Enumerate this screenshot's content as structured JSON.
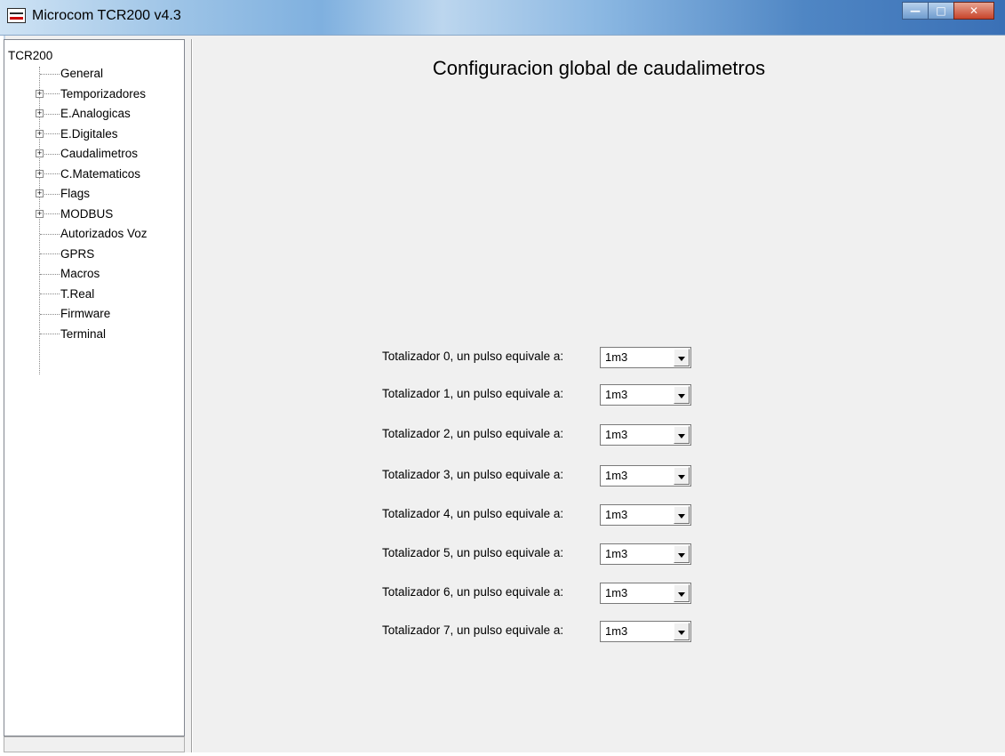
{
  "window": {
    "title": "Microcom TCR200 v4.3",
    "controls": [
      "minimize-icon",
      "maximize-icon",
      "close-icon"
    ]
  },
  "tree": {
    "root": "TCR200",
    "items": [
      {
        "label": "General",
        "expandable": false
      },
      {
        "label": "Temporizadores",
        "expandable": true
      },
      {
        "label": "E.Analogicas",
        "expandable": true
      },
      {
        "label": "E.Digitales",
        "expandable": true
      },
      {
        "label": "Caudalimetros",
        "expandable": true
      },
      {
        "label": "C.Matematicos",
        "expandable": true
      },
      {
        "label": "Flags",
        "expandable": true
      },
      {
        "label": "MODBUS",
        "expandable": true
      },
      {
        "label": "Autorizados Voz",
        "expandable": false
      },
      {
        "label": "GPRS",
        "expandable": false
      },
      {
        "label": "Macros",
        "expandable": false
      },
      {
        "label": "T.Real",
        "expandable": false
      },
      {
        "label": "Firmware",
        "expandable": false
      },
      {
        "label": "Terminal",
        "expandable": false
      }
    ]
  },
  "main": {
    "title": "Configuracion global de caudalimetros",
    "totalizers": [
      {
        "label": "Totalizador 0, un pulso equivale a:",
        "value": "1m3"
      },
      {
        "label": "Totalizador 1, un pulso equivale a:",
        "value": "1m3"
      },
      {
        "label": "Totalizador 2, un pulso equivale a:",
        "value": "1m3"
      },
      {
        "label": "Totalizador 3, un pulso equivale a:",
        "value": "1m3"
      },
      {
        "label": "Totalizador 4, un pulso equivale a:",
        "value": "1m3"
      },
      {
        "label": "Totalizador 5, un pulso equivale a:",
        "value": "1m3"
      },
      {
        "label": "Totalizador 6, un pulso equivale a:",
        "value": "1m3"
      },
      {
        "label": "Totalizador 7, un pulso equivale a:",
        "value": "1m3"
      }
    ]
  }
}
